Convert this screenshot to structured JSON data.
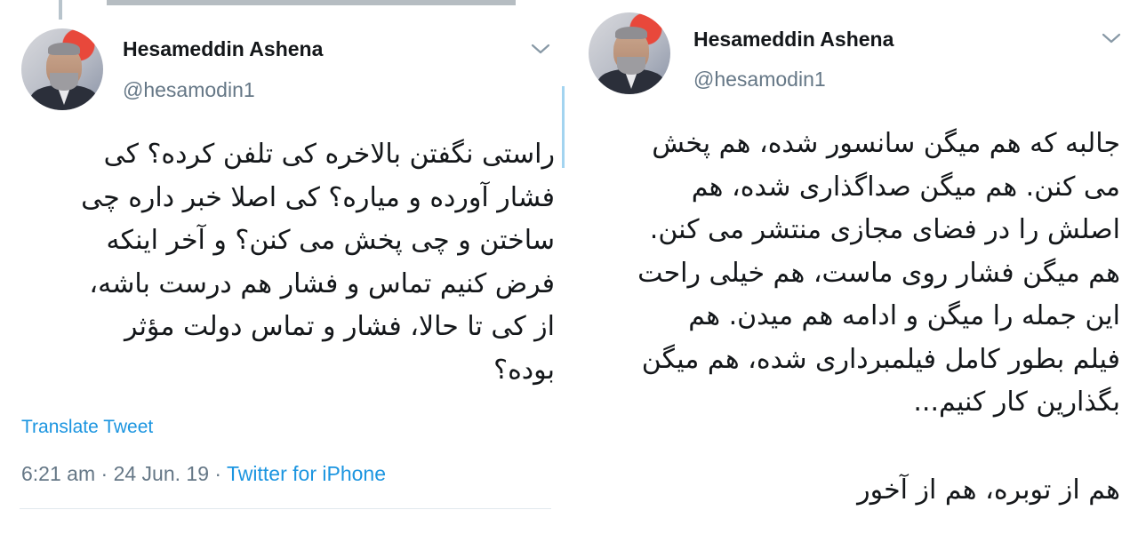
{
  "left_tweet": {
    "author_name": "Hesameddin Ashena",
    "handle": "@hesamodin1",
    "text": "راستی نگفتن بالاخره کی تلفن کرده؟ کی\nفشار آورده و میاره؟ کی اصلا خبر داره چی\nساختن و چی پخش می کنن؟ و آخر اینکه\nفرض کنیم تماس و فشار هم درست باشه،\nاز کی تا حالا، فشار و تماس دولت مؤثر\nبوده؟",
    "translate_label": "Translate Tweet",
    "time": "6:21 am",
    "date": "24 Jun. 19",
    "separator": "·",
    "source": "Twitter for iPhone",
    "avatar_icon": "profile-photo",
    "menu_icon": "chevron-down-icon"
  },
  "right_tweet": {
    "author_name": "Hesameddin Ashena",
    "handle": "@hesamodin1",
    "text": "جالبه که هم میگن سانسور شده، هم پخش\nمی کنن. هم میگن صداگذاری شده، هم\nاصلش را در فضای مجازی منتشر می کنن.\nهم میگن فشار روی ماست، هم خیلی راحت\nاین جمله را میگن و ادامه هم میدن. هم\nفیلم بطور کامل فیلمبرداری شده، هم میگن\nبگذارین کار کنیم...",
    "text_end": "هم از توبره، هم از آخور",
    "avatar_icon": "profile-photo",
    "menu_icon": "chevron-down-icon"
  },
  "colors": {
    "text": "#14171a",
    "secondary": "#657786",
    "link": "#1b95e0",
    "divider": "#e1e8ed",
    "thread_line": "#a3d4f0"
  }
}
